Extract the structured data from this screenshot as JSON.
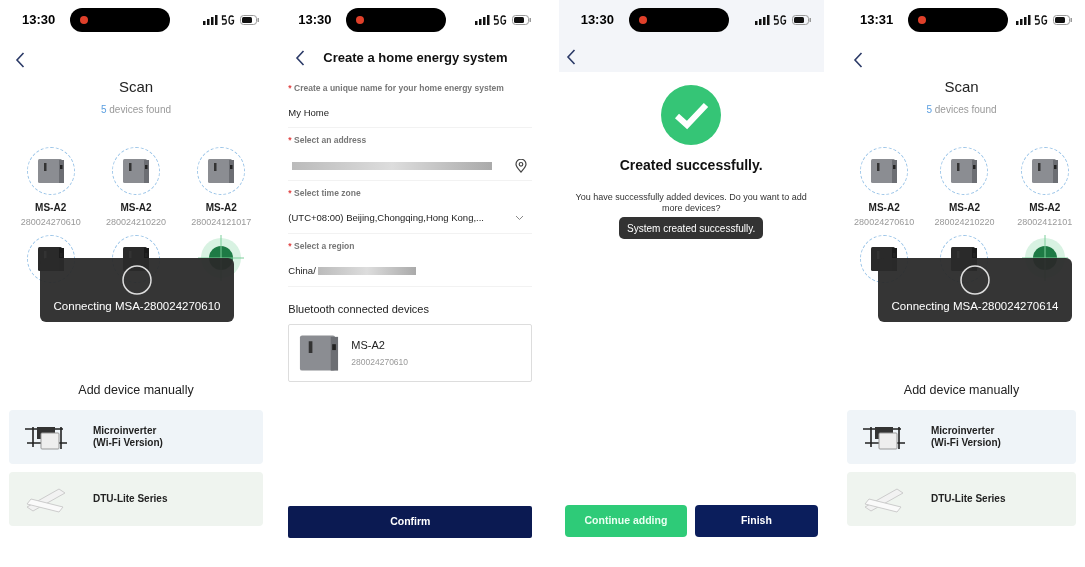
{
  "screens": [
    {
      "kind": "scan",
      "time": "13:30",
      "title": "Scan",
      "count": "5",
      "count_suffix": "devices found",
      "devices": [
        {
          "name": "MS-A2",
          "serial": "280024270610"
        },
        {
          "name": "MS-A2",
          "serial": "280024210220"
        },
        {
          "name": "MS-A2",
          "serial": "280024121017"
        }
      ],
      "toast": "Connecting MSA-280024270610",
      "manual_title": "Add device manually",
      "options": [
        {
          "kind": "microinverter",
          "label": "Microinverter\n(Wi-Fi Version)"
        },
        {
          "kind": "dtu",
          "label": "DTU-Lite Series"
        }
      ]
    },
    {
      "kind": "form",
      "time": "13:30",
      "title": "Create a home energy system",
      "fields": [
        {
          "mark": "*",
          "label": "Create a unique name for your home energy system",
          "value": "My Home",
          "blurred": false,
          "kind": "text"
        },
        {
          "mark": "*",
          "label": "Select an address",
          "blurred": true,
          "kind": "location"
        },
        {
          "mark": "*",
          "label": "Select time zone",
          "value": "(UTC+08:00) Beijing,Chongqing,Hong Kong,...",
          "blurred": false,
          "kind": "select"
        },
        {
          "mark": "*",
          "label": "Select a region",
          "value": "China/",
          "blurred": true,
          "kind": "text"
        }
      ],
      "section": "Bluetooth connected devices",
      "device": {
        "name": "MS-A2",
        "serial": "280024270610"
      },
      "button": "Confirm"
    },
    {
      "kind": "success",
      "time": "13:30",
      "title": "Created successfully.",
      "message": "You have successfully added devices. Do you want to add more devices?",
      "toast": "System created successfully.",
      "buttons": [
        {
          "label": "Continue adding",
          "kind": "secondary"
        },
        {
          "label": "Finish",
          "kind": "primary"
        }
      ]
    },
    {
      "kind": "scan",
      "time": "13:31",
      "title": "Scan",
      "count": "5",
      "count_suffix": "devices found",
      "devices": [
        {
          "name": "MS-A2",
          "serial": "280024270610"
        },
        {
          "name": "MS-A2",
          "serial": "280024210220"
        },
        {
          "name": "MS-A2",
          "serial": "28002412101"
        }
      ],
      "toast": "Connecting MSA-280024270614",
      "manual_title": "Add device manually",
      "options": [
        {
          "kind": "microinverter",
          "label": "Microinverter\n(Wi-Fi Version)"
        },
        {
          "kind": "dtu",
          "label": "DTU-Lite Series"
        }
      ]
    }
  ]
}
